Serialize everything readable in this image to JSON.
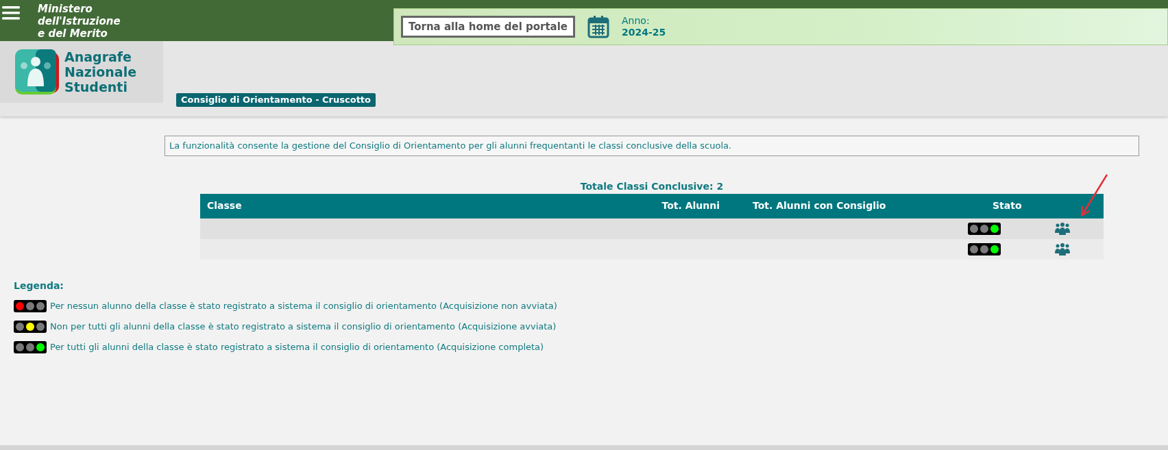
{
  "header": {
    "ministry": [
      "Ministero",
      "dell'Istruzione",
      "e del Merito"
    ],
    "home_button": "Torna alla home del portale",
    "year_label": "Anno:",
    "year_value": "2024-25"
  },
  "app": {
    "name": [
      "Anagrafe",
      "Nazionale",
      "Studenti"
    ]
  },
  "tabs": [
    {
      "label": "Consiglio di Orientamento - Cruscotto",
      "selected": true
    }
  ],
  "description": "La funzionalità consente la gestione del Consiglio di Orientamento per gli alunni frequentanti le classi conclusive della scuola.",
  "table": {
    "total": "Totale Classi Conclusive: 2",
    "columns": [
      "Classe",
      "Tot. Alunni",
      "Tot. Alunni con Consiglio",
      "Stato"
    ],
    "rows": [
      {
        "red_on": false,
        "yellow_on": false,
        "green_on": true
      },
      {
        "red_on": false,
        "yellow_on": false,
        "green_on": true
      }
    ]
  },
  "legend": {
    "title": "Legenda:",
    "items": [
      {
        "red_on": true,
        "yellow_on": false,
        "green_on": false,
        "text": "Per nessun alunno della classe è stato registrato a sistema il consiglio di orientamento (Acquisizione non avviata)"
      },
      {
        "red_on": false,
        "yellow_on": true,
        "green_on": false,
        "text": "Non per tutti gli alunni della classe è stato registrato a sistema il consiglio di orientamento (Acquisizione avviata)"
      },
      {
        "red_on": false,
        "yellow_on": false,
        "green_on": true,
        "text": "Per tutti gli alunni della classe è stato registrato a sistema il consiglio di orientamento (Acquisizione completa)"
      }
    ]
  }
}
